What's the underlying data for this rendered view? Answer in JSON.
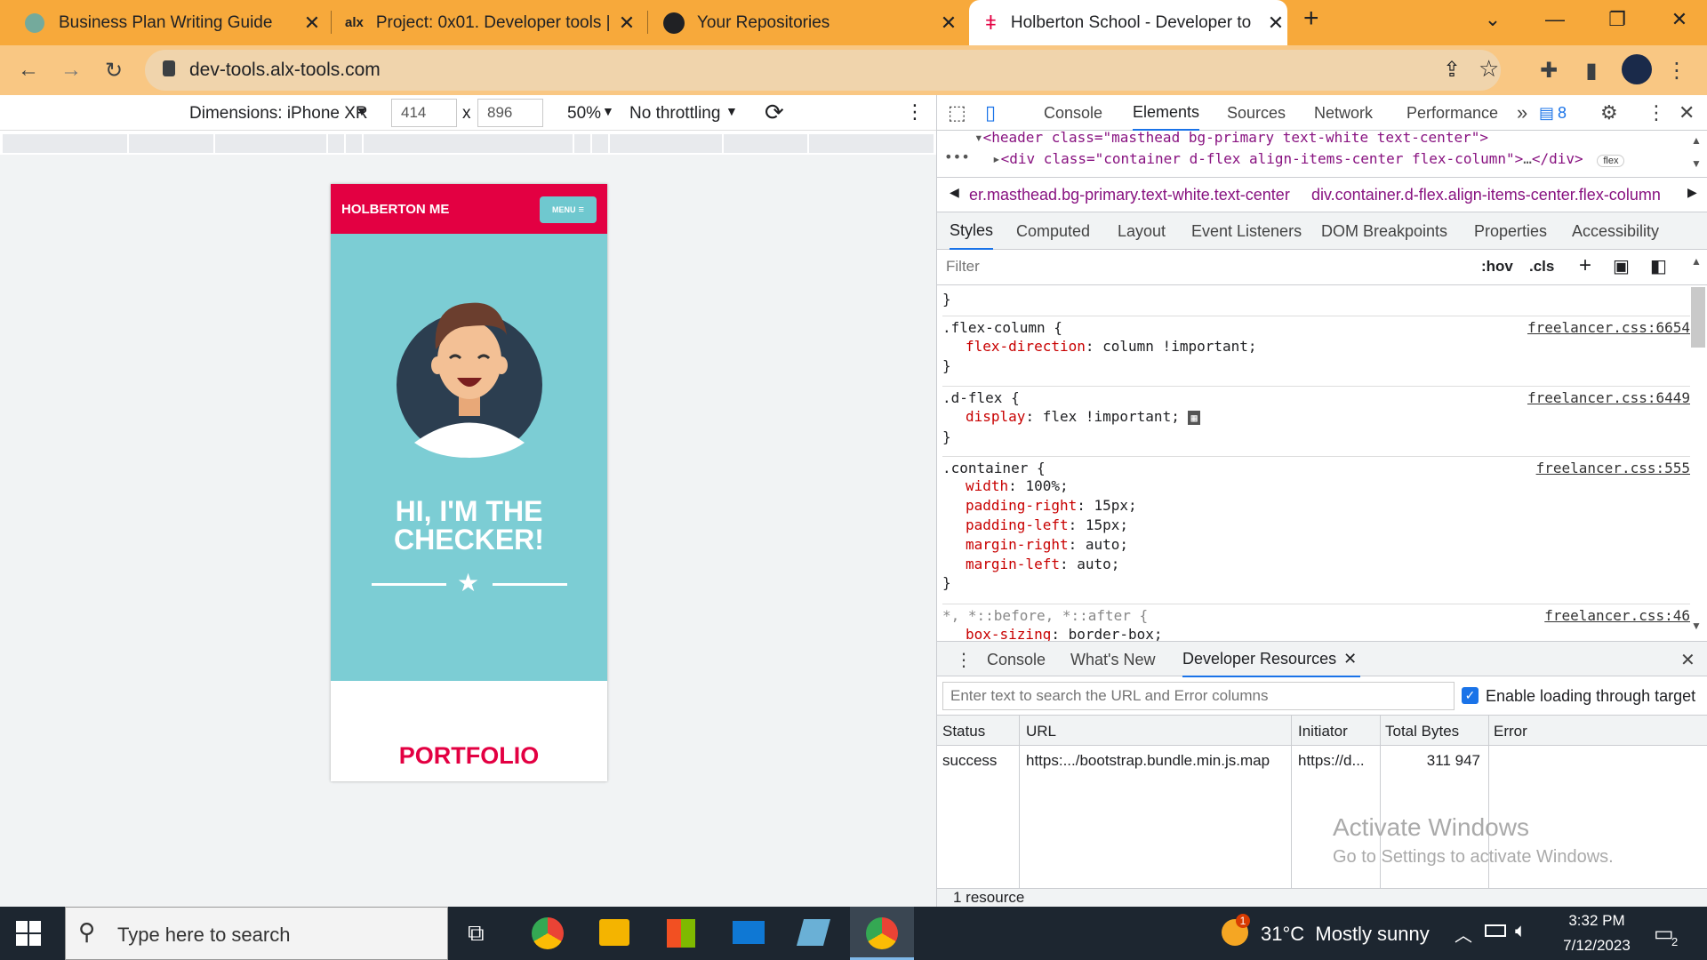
{
  "browser": {
    "tabs": [
      {
        "title": "Business Plan Writing Guide",
        "icon": "chatgpt-icon"
      },
      {
        "title": "Project: 0x01. Developer tools | L",
        "icon": "alx-icon"
      },
      {
        "title": "Your Repositories",
        "icon": "github-icon"
      },
      {
        "title": "Holberton School - Developer to",
        "icon": "holberton-icon"
      }
    ],
    "new_tab": "+",
    "url": "dev-tools.alx-tools.com"
  },
  "device_toolbar": {
    "dimensions_label": "Dimensions: iPhone XR",
    "width": "414",
    "times": "x",
    "height": "896",
    "zoom": "50%",
    "throttling": "No throttling"
  },
  "page": {
    "brand": "HOLBERTON ME",
    "menu_label": "MENU",
    "heading_line1": "HI, I'M THE",
    "heading_line2": "CHECKER!",
    "section_title": "PORTFOLIO",
    "colors": {
      "primary": "#e30042",
      "masthead": "#7ccdd4",
      "avatar_bg": "#2c3e50"
    }
  },
  "devtools": {
    "main_tabs": [
      "Console",
      "Elements",
      "Sources",
      "Network",
      "Performance"
    ],
    "active_main_tab": "Elements",
    "more_tabs": "»",
    "issues_count": "8",
    "dom": {
      "line1": "<header class=\"masthead bg-primary text-white text-center\">",
      "line2_tag": "<div class=\"container d-flex align-items-center flex-column\">",
      "line2_close": "</div>",
      "ellipsis": "…",
      "badge": "flex"
    },
    "breadcrumbs": [
      "er.masthead.bg-primary.text-white.text-center",
      "div.container.d-flex.align-items-center.flex-column"
    ],
    "style_tabs": [
      "Styles",
      "Computed",
      "Layout",
      "Event Listeners",
      "DOM Breakpoints",
      "Properties",
      "Accessibility"
    ],
    "filter_placeholder": "Filter",
    "hov": ":hov",
    "cls": ".cls",
    "rules": [
      {
        "selector": ".flex-column {",
        "source": "freelancer.css:6654",
        "props": [
          {
            "name": "flex-direction",
            "value": "column !important;"
          }
        ]
      },
      {
        "selector": ".d-flex {",
        "source": "freelancer.css:6449",
        "props": [
          {
            "name": "display",
            "value": "flex !important;"
          }
        ]
      },
      {
        "selector": ".container {",
        "source": "freelancer.css:555",
        "props": [
          {
            "name": "width",
            "value": "100%;"
          },
          {
            "name": "padding-right",
            "value": "15px;"
          },
          {
            "name": "padding-left",
            "value": "15px;"
          },
          {
            "name": "margin-right",
            "value": "auto;"
          },
          {
            "name": "margin-left",
            "value": "auto;"
          }
        ]
      },
      {
        "selector": "*, *::before, *::after {",
        "source": "freelancer.css:46",
        "props": [
          {
            "name": "box-sizing",
            "value": "border-box;"
          }
        ]
      }
    ],
    "close_brace": "}",
    "drawer": {
      "tabs": [
        "Console",
        "What's New",
        "Developer Resources"
      ],
      "active": "Developer Resources",
      "search_placeholder": "Enter text to search the URL and Error columns",
      "checkbox_label": "Enable loading through target",
      "columns": [
        "Status",
        "URL",
        "Initiator",
        "Total Bytes",
        "Error"
      ],
      "rows": [
        {
          "status": "success",
          "url": "https:.../bootstrap.bundle.min.js.map",
          "initiator": "https://d...",
          "bytes": "311 947",
          "error": ""
        }
      ],
      "footer": "1 resource"
    },
    "watermark_line1": "Activate Windows",
    "watermark_line2": "Go to Settings to activate Windows."
  },
  "taskbar": {
    "search_placeholder": "Type here to search",
    "weather": "31°C  Mostly sunny",
    "weather_badge": "1",
    "time": "3:32 PM",
    "date": "7/12/2023",
    "notifications": "2"
  }
}
